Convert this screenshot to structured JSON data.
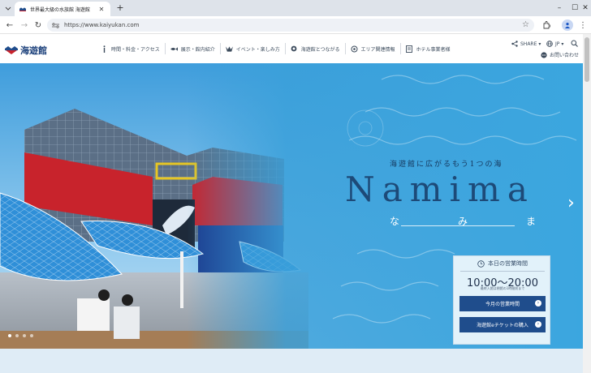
{
  "browser": {
    "tab_title": "世界最大級の水族館 海遊館",
    "new_tab": "+",
    "url": "https://www.kaiyukan.com",
    "window_controls": [
      "–",
      "☐",
      "✕"
    ]
  },
  "header": {
    "logo_text": "海遊館",
    "nav": [
      {
        "label": "時間・料金・アクセス",
        "icon": "info-icon"
      },
      {
        "label": "展示・館内紹介",
        "icon": "fish-icon"
      },
      {
        "label": "イベント・楽しみ方",
        "icon": "crown-icon"
      },
      {
        "label": "海遊館とつながる",
        "icon": "circle-icon"
      },
      {
        "label": "エリア関連情報",
        "icon": "target-icon"
      },
      {
        "label": "ホテル事業者様",
        "icon": "building-icon"
      }
    ],
    "share_label": "SHARE",
    "lang_label": "JP",
    "contact_label": "お問い合わせ"
  },
  "hero": {
    "tagline": "海遊館に広がるもう1つの海",
    "title": "Namima",
    "kana": [
      "な",
      "み",
      "ま"
    ],
    "slide_count": 4
  },
  "hours": {
    "heading": "本日の営業時間",
    "time": "10:00〜20:00",
    "note": "最終入館は閉館の1時間前まで",
    "btn_month": "今月の営業時間",
    "btn_ticket": "海遊館eチケットの購入"
  },
  "colors": {
    "brand_navy": "#1f4d8c",
    "building_red": "#c8232c",
    "water_blue": "#3d9fd8"
  }
}
